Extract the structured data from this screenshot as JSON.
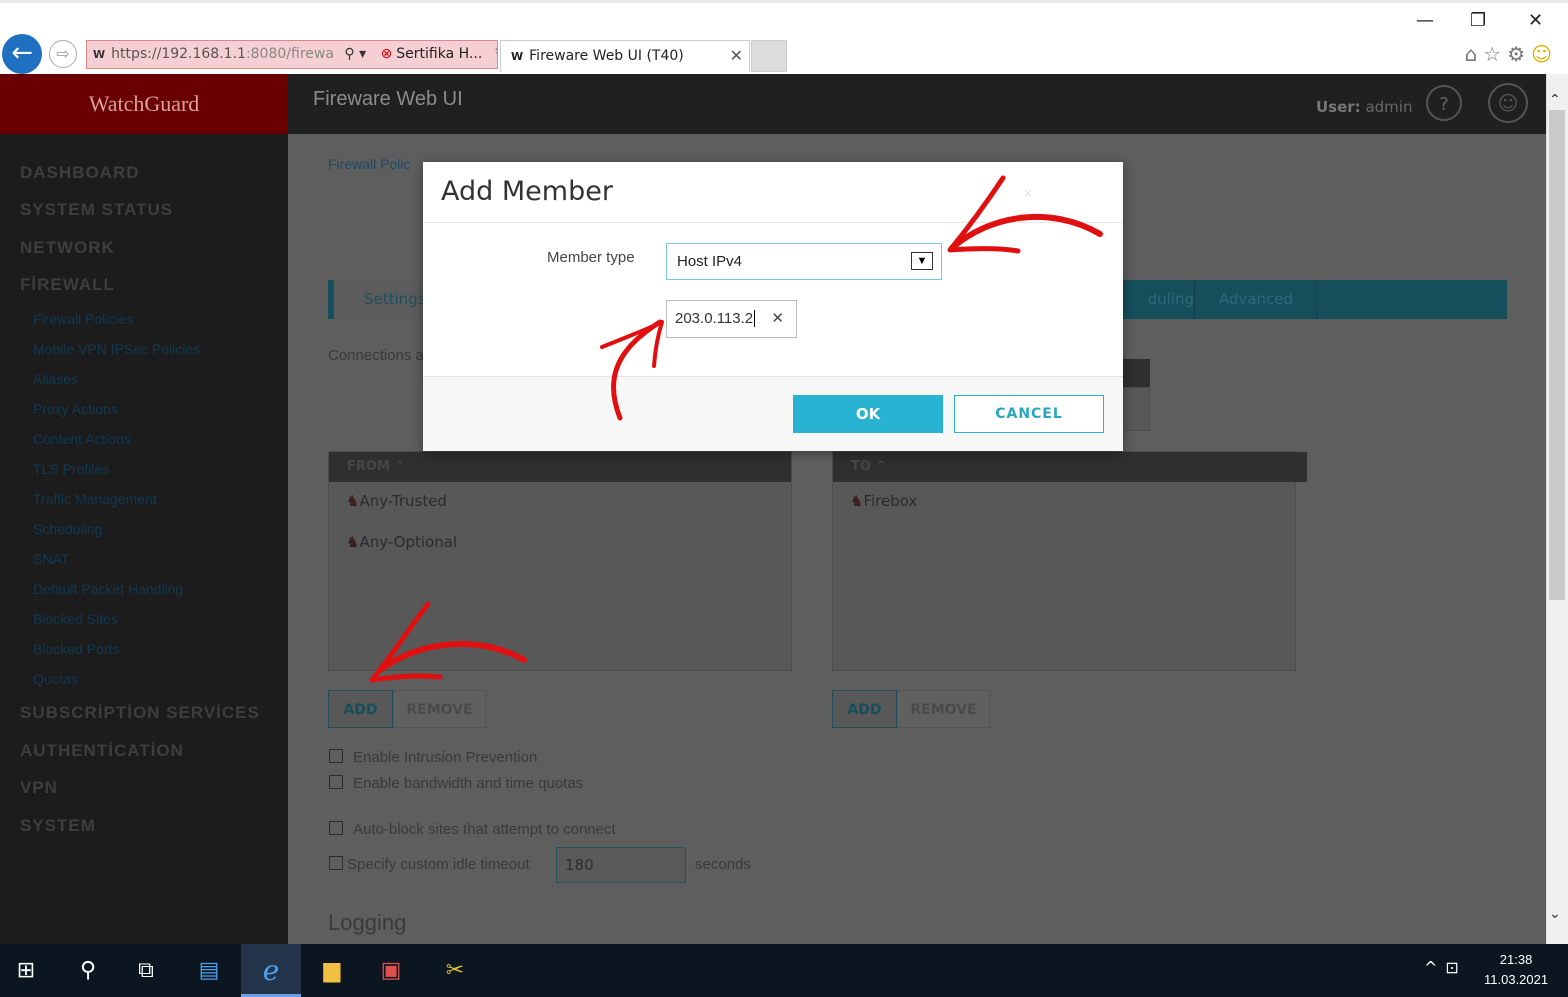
{
  "browser": {
    "window_controls": [
      "—",
      "❐",
      "✕"
    ],
    "address_fav": "W",
    "url_host": "https://192.168.1.1",
    "url_rest": ":8080/firewa",
    "cert_label": "Sertifika H...",
    "tab_title": "Fireware Web UI (T40)",
    "tab_close": "✕"
  },
  "app": {
    "logo": "WatchGuard",
    "title": "Fireware Web UI",
    "user_label": "User:",
    "user_name": "admin",
    "help": "?"
  },
  "sidebar": {
    "main": [
      "DASHBOARD",
      "SYSTEM STATUS",
      "NETWORK",
      "FİREWALL"
    ],
    "firewall_items": [
      "Firewall Policies",
      "Mobile VPN IPSec Policies",
      "Aliases",
      "Proxy Actions",
      "Content Actions",
      "TLS Profiles",
      "Traffic Management",
      "Scheduling",
      "SNAT",
      "Default Packet Handling",
      "Blocked Sites",
      "Blocked Ports",
      "Quotas"
    ],
    "main_after": [
      "SUBSCRİPTİON SERVİCES",
      "AUTHENTİCATİON",
      "VPN",
      "SYSTEM"
    ]
  },
  "content": {
    "breadcrumb": "Firewall Polic",
    "tabs": {
      "settings": "Settings",
      "scheduling": "duling",
      "advanced": "Advanced"
    },
    "connections_label": "Connections a",
    "from_header": "FROM ⌃",
    "from_items": [
      "Any-Trusted",
      "Any-Optional"
    ],
    "to_header": "TO ⌃",
    "to_items": [
      "Firebox"
    ],
    "add": "ADD",
    "remove": "REMOVE",
    "checkboxes": [
      "Enable Intrusion Prevention",
      "Enable bandwidth and time quotas",
      "Auto-block sites that attempt to connect",
      "Specify custom idle timeout"
    ],
    "idle_value": "180",
    "seconds": "seconds",
    "logging": "Logging"
  },
  "modal": {
    "title": "Add Member",
    "close": "×",
    "member_type_label": "Member type",
    "member_type_value": "Host IPv4",
    "host_value": "203.0.113.2",
    "ok": "OK",
    "cancel": "CANCEL"
  },
  "taskbar": {
    "time": "21:38",
    "date": "11.03.2021"
  },
  "colors": {
    "accent": "#27b3d1",
    "arrow": "#e01010"
  }
}
